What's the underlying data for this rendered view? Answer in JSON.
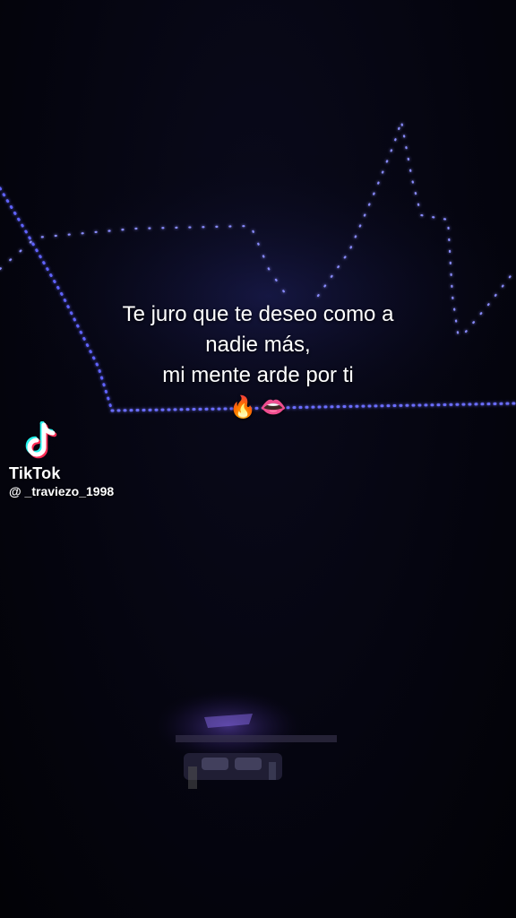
{
  "caption": {
    "line1": "Te juro que te deseo como a",
    "line2": "nadie más,",
    "line3": "mi mente arde por ti",
    "emojis": [
      "🔥",
      "👄"
    ]
  },
  "watermark": {
    "brand": "TikTok",
    "handle": "@ _traviezo_1998",
    "logo_colors": {
      "cyan": "#25F4EE",
      "red": "#FE2C55",
      "white": "#FFFFFF"
    }
  },
  "scene": {
    "led_color": "#5a5cff",
    "background": "#03030a"
  }
}
